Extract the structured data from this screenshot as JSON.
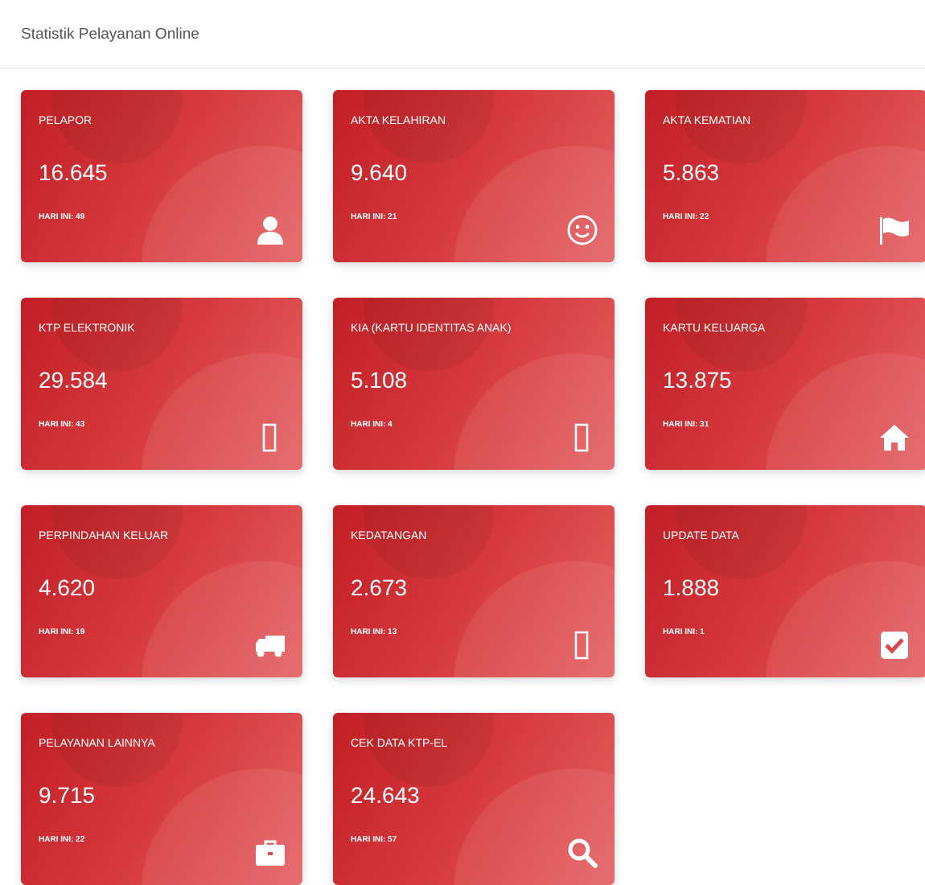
{
  "title": "Statistik Pelayanan Online",
  "cards": [
    {
      "label": "PELAPOR",
      "value": "16.645",
      "today": "HARI INI: 49",
      "kind": "user"
    },
    {
      "label": "AKTA KELAHIRAN",
      "value": "9.640",
      "today": "HARI INI: 21",
      "kind": "smile"
    },
    {
      "label": "AKTA KEMATIAN",
      "value": "5.863",
      "today": "HARI INI: 22",
      "kind": "flag"
    },
    {
      "label": "KTP ELEKTRONIK",
      "value": "29.584",
      "today": "HARI INI: 43",
      "kind": "box"
    },
    {
      "label": "KIA (KARTU IDENTITAS ANAK)",
      "value": "5.108",
      "today": "HARI INI: 4",
      "kind": "box"
    },
    {
      "label": "KARTU KELUARGA",
      "value": "13.875",
      "today": "HARI INI: 31",
      "kind": "home"
    },
    {
      "label": "PERPINDAHAN KELUAR",
      "value": "4.620",
      "today": "HARI INI: 19",
      "kind": "truck"
    },
    {
      "label": "KEDATANGAN",
      "value": "2.673",
      "today": "HARI INI: 13",
      "kind": "box"
    },
    {
      "label": "UPDATE DATA",
      "value": "1.888",
      "today": "HARI INI: 1",
      "kind": "check"
    },
    {
      "label": "PELAYANAN LAINNYA",
      "value": "9.715",
      "today": "HARI INI: 22",
      "kind": "briefcase"
    },
    {
      "label": "CEK DATA KTP-EL",
      "value": "24.643",
      "today": "HARI INI: 57",
      "kind": "search"
    }
  ]
}
